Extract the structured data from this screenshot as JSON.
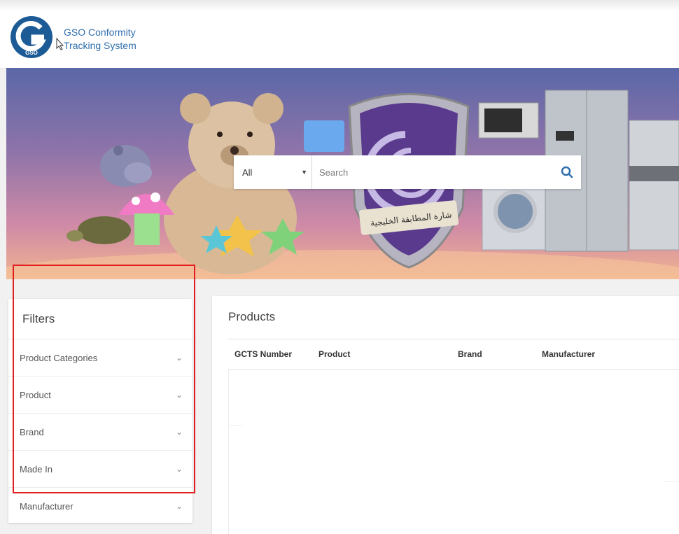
{
  "header": {
    "logo_text_line1": "GSO Conformity",
    "logo_text_line2": "Tracking System",
    "logo_badge": "GSO"
  },
  "banner": {
    "shield_arabic_text": "شارة المطابقة الخليجية"
  },
  "search": {
    "category_selected": "All",
    "placeholder": "Search",
    "icon": "search-icon"
  },
  "filters": {
    "title": "Filters",
    "items": [
      {
        "label": "Product Categories"
      },
      {
        "label": "Product"
      },
      {
        "label": "Brand"
      },
      {
        "label": "Made In"
      },
      {
        "label": "Manufacturer"
      }
    ]
  },
  "products": {
    "title": "Products",
    "columns": [
      "GCTS Number",
      "Product",
      "Brand",
      "Manufacturer"
    ]
  },
  "colors": {
    "accent": "#2f6fae",
    "highlight_box": "#e02020",
    "banner_top": "#5b67a8",
    "banner_bottom": "#f0b38f"
  }
}
